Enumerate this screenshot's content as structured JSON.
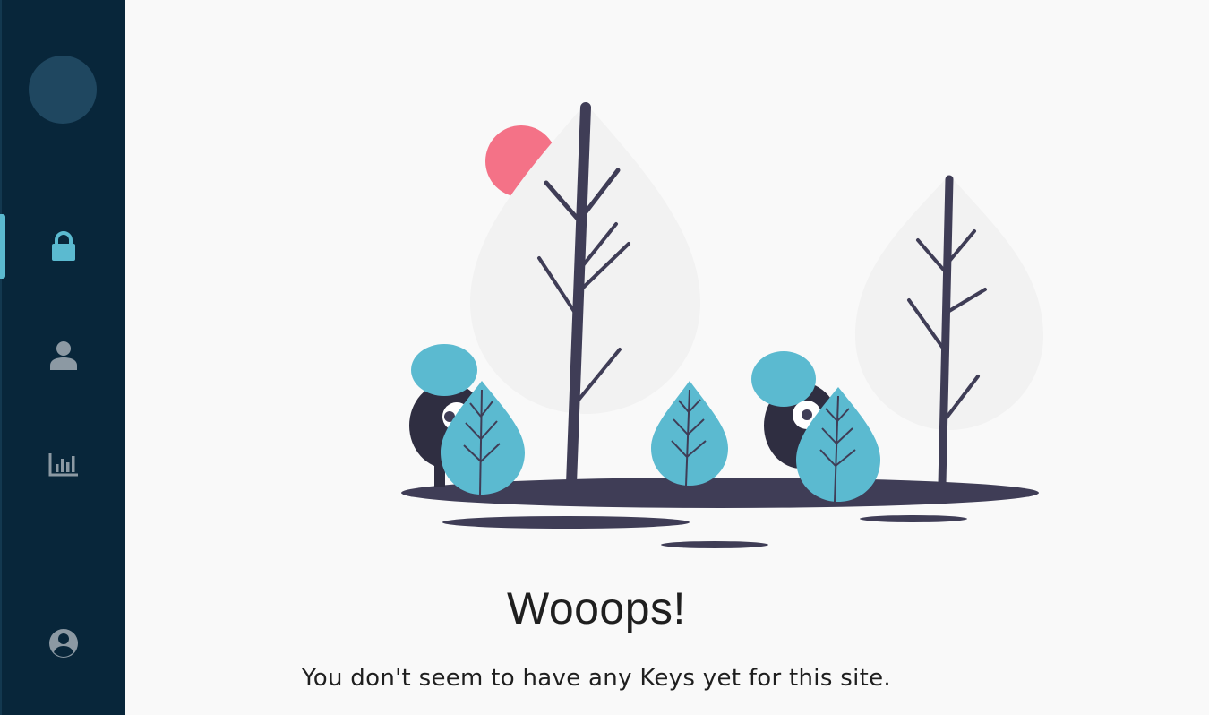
{
  "sidebar": {
    "items": [
      {
        "id": "keys",
        "icon": "lock-icon",
        "active": true
      },
      {
        "id": "account",
        "icon": "person-icon",
        "active": false
      },
      {
        "id": "stats",
        "icon": "bar-chart-icon",
        "active": false
      },
      {
        "id": "profile",
        "icon": "account-circle-icon",
        "active": false
      }
    ]
  },
  "colors": {
    "sidebar_bg": "#08263a",
    "accent": "#5bbad0",
    "icon_inactive": "#8c99a3",
    "sun": "#f47287",
    "dark": "#3f3d56"
  },
  "empty_state": {
    "title": "Wooops!",
    "message": "You don't seem to have any Keys yet for this site."
  }
}
